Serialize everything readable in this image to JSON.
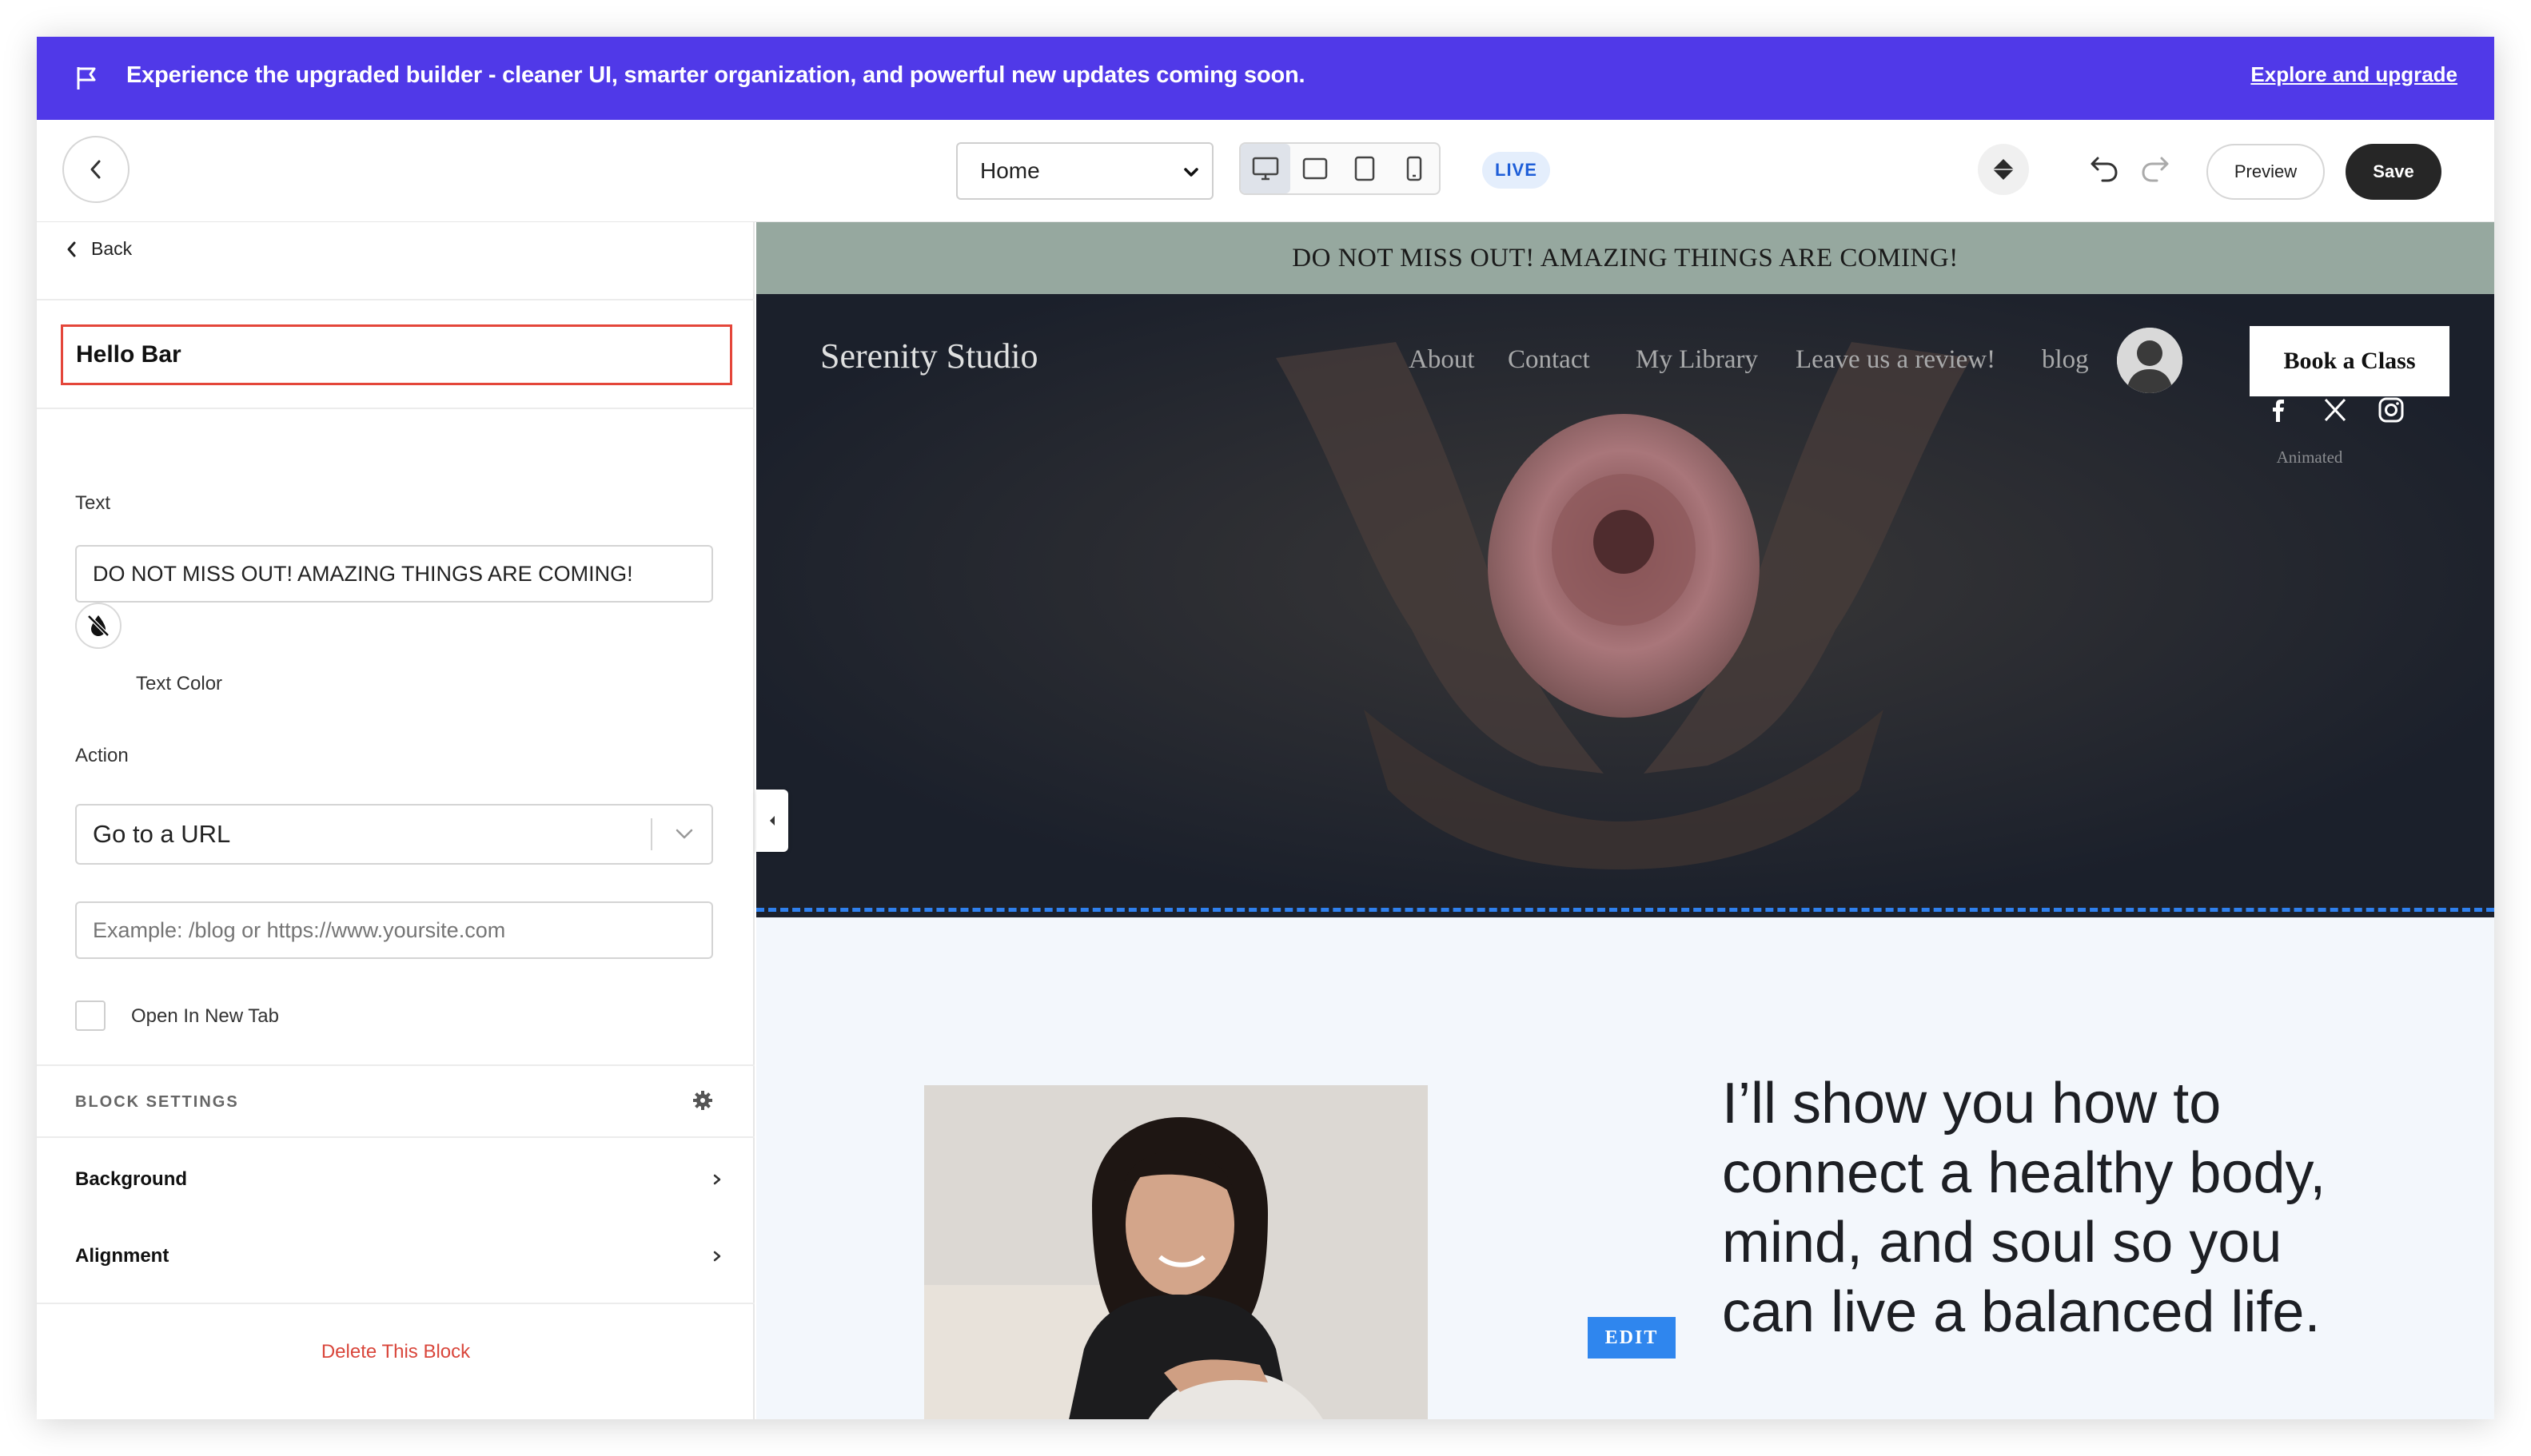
{
  "banner": {
    "message": "Experience the upgraded builder - cleaner UI, smarter organization, and powerful new updates coming soon.",
    "link": "Explore and upgrade",
    "color": "#5039e8"
  },
  "toolbar": {
    "page_select": "Home",
    "live_badge": "LIVE",
    "preview_label": "Preview",
    "save_label": "Save",
    "devices": [
      "desktop-icon",
      "tablet-landscape-icon",
      "tablet-portrait-icon",
      "mobile-icon"
    ],
    "active_device": "desktop-icon"
  },
  "panel": {
    "back_label": "Back",
    "block_name": "Hello Bar",
    "text_label": "Text",
    "text_value": "DO NOT MISS OUT! AMAZING THINGS ARE COMING!",
    "text_color_label": "Text Color",
    "action_label": "Action",
    "action_value": "Go to a URL",
    "url_placeholder": "Example: /blog or https://www.yoursite.com",
    "new_tab_label": "Open In New Tab",
    "new_tab_checked": false,
    "block_settings_title": "BLOCK SETTINGS",
    "background_label": "Background",
    "alignment_label": "Alignment",
    "delete_label": "Delete This Block"
  },
  "site": {
    "hello_bar": "DO NOT MISS OUT! AMAZING THINGS ARE COMING!",
    "brand": "Serenity Studio",
    "nav": [
      "About",
      "Contact",
      "My Library",
      "Leave us a review!",
      "blog"
    ],
    "cta": "Book a Class",
    "socials": [
      "facebook-icon",
      "x-icon",
      "instagram-icon"
    ],
    "animated_caption": "Animated",
    "edit_badge": "EDIT",
    "headline": "I’ll show you how to connect a healthy body, mind, and soul so you can live a balanced life.",
    "hello_bar_color": "#96a89f",
    "accent": "#2f80ed"
  }
}
